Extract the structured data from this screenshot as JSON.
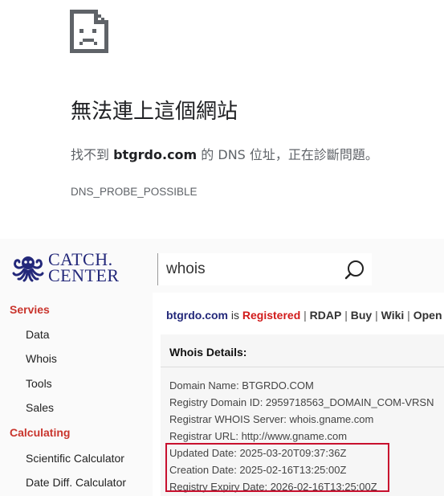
{
  "error_page": {
    "title": "無法連上這個網站",
    "message_prefix": "找不到 ",
    "message_domain": "btgrdo.com",
    "message_suffix": " 的 DNS 位址，正在診斷問題。",
    "error_code": "DNS_PROBE_POSSIBLE",
    "icon": "sad-document-icon"
  },
  "site": {
    "logo": {
      "text": "CATCH.\nCENTER",
      "icon": "octopus-logo-icon",
      "color": "#23287a"
    },
    "search": {
      "value": "whois",
      "icon": "search-icon"
    },
    "sidebar": {
      "sections": [
        {
          "heading": "Servies",
          "items": [
            "Data",
            "Whois",
            "Tools",
            "Sales"
          ]
        },
        {
          "heading": "Calculating",
          "items": [
            "Scientific Calculator",
            "Date Diff. Calculator"
          ]
        }
      ],
      "heading_color": "#c9352d"
    },
    "status": {
      "domain": "btgrdo.com",
      "is_text": " is ",
      "registered": "Registered",
      "links": [
        "RDAP",
        "Buy",
        "Wiki",
        "Open"
      ],
      "separator": " | "
    },
    "details": {
      "title": "Whois Details:",
      "lines": [
        "Domain Name: BTGRDO.COM",
        "Registry Domain ID: 2959718563_DOMAIN_COM-VRSN",
        "Registrar WHOIS Server: whois.gname.com",
        "Registrar URL: http://www.gname.com",
        "Updated Date: 2025-03-20T09:37:36Z",
        "Creation Date: 2025-02-16T13:25:00Z",
        "Registry Expiry Date: 2026-02-16T13:25:00Z"
      ],
      "highlight_color": "#c8102e"
    }
  }
}
